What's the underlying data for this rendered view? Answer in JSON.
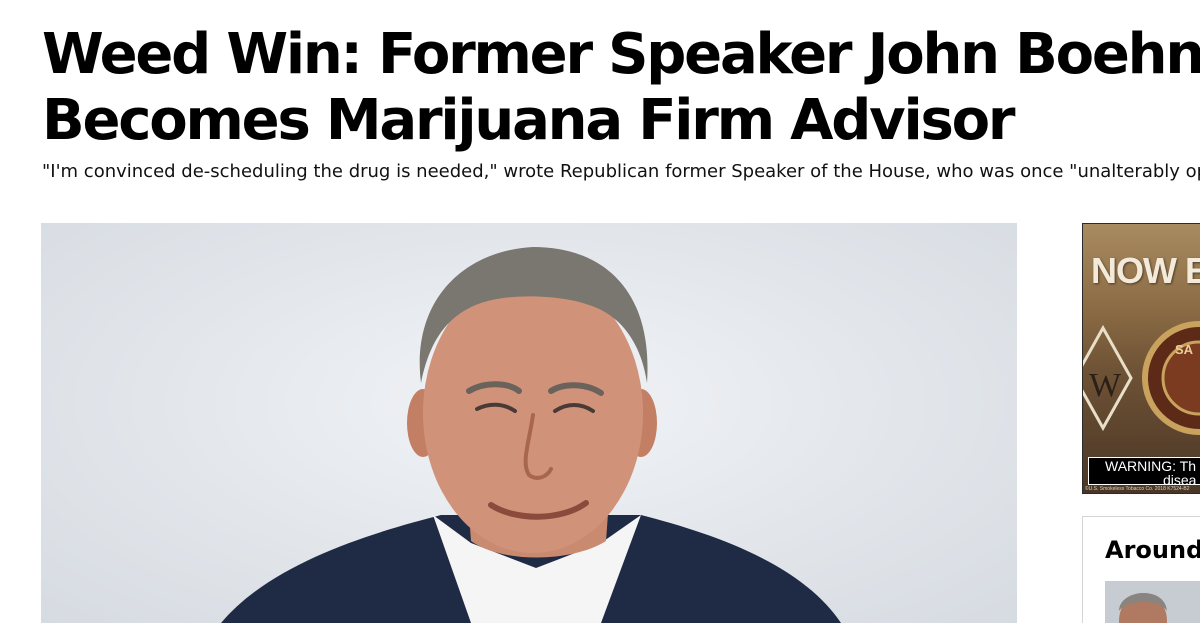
{
  "article": {
    "headline_line1": "Weed Win: Former Speaker John Boehner",
    "headline_line2": "Becomes Marijuana Firm Advisor",
    "dek": "\"I'm convinced de-scheduling the drug is needed,\" wrote Republican former Speaker of the House, who was once \"unalterably op"
  },
  "ad": {
    "headline": "NOW EV",
    "warning_line1": "WARNING: Th",
    "warning_line2": "disea",
    "fine_print": "©U.S. Smokeless Tobacco Co. 2018   K7524-B2"
  },
  "rail": {
    "around_title": "Around"
  }
}
